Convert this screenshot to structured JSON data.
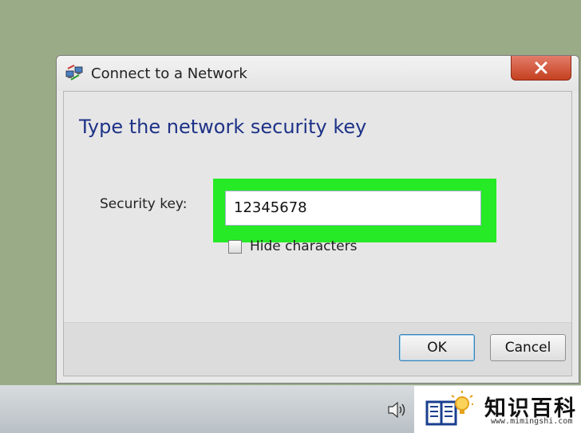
{
  "window": {
    "title": "Connect to a Network",
    "close_label": "close"
  },
  "main": {
    "heading": "Type the network security key",
    "security_key_label": "Security key:",
    "security_key_value": "12345678",
    "hide_characters_label": "Hide characters",
    "hide_characters_checked": false
  },
  "buttons": {
    "ok": "OK",
    "cancel": "Cancel"
  },
  "taskbar": {
    "speaker_icon": "speaker-icon"
  },
  "watermark": {
    "name": "知识百科",
    "url": "www.mimingshi.com"
  },
  "colors": {
    "highlight": "#25ea25",
    "heading": "#1e3287",
    "close_button": "#c5401f"
  }
}
